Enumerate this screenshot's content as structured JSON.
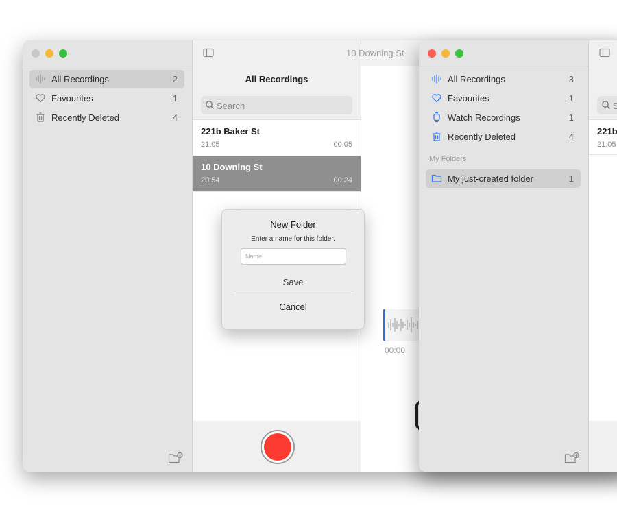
{
  "window1": {
    "title": "10 Downing St",
    "sidebar": [
      {
        "label": "All Recordings",
        "count": "2",
        "icon": "waveform-icon"
      },
      {
        "label": "Favourites",
        "count": "1",
        "icon": "heart-icon"
      },
      {
        "label": "Recently Deleted",
        "count": "4",
        "icon": "trash-icon"
      }
    ],
    "list_title": "All Recordings",
    "search_placeholder": "Search",
    "recordings": [
      {
        "title": "221b Baker St",
        "date": "21:05",
        "duration": "00:05"
      },
      {
        "title": "10 Downing St",
        "date": "20:54",
        "duration": "00:24"
      }
    ],
    "playhead_time": "00:00"
  },
  "dialog": {
    "title": "New Folder",
    "message": "Enter a name for this folder.",
    "name_placeholder": "Name",
    "save_label": "Save",
    "cancel_label": "Cancel"
  },
  "window2": {
    "sidebar": [
      {
        "label": "All Recordings",
        "count": "3",
        "icon": "waveform-icon"
      },
      {
        "label": "Favourites",
        "count": "1",
        "icon": "heart-icon"
      },
      {
        "label": "Watch Recordings",
        "count": "1",
        "icon": "watch-icon"
      },
      {
        "label": "Recently Deleted",
        "count": "4",
        "icon": "trash-icon"
      }
    ],
    "section_header": "My Folders",
    "folders": [
      {
        "label": "My just-created folder",
        "count": "1",
        "icon": "folder-icon"
      }
    ],
    "search_placeholder": "Se",
    "recordings": [
      {
        "title": "221b",
        "date": "21:05"
      }
    ]
  },
  "colors": {
    "accent": "#3478f6",
    "record_red": "#fe3b30",
    "selected_row": "#8f8f8f"
  }
}
